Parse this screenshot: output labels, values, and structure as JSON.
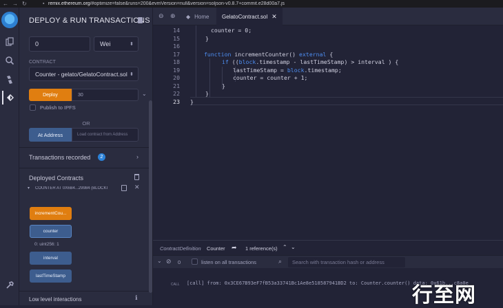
{
  "browser": {
    "url_host": "remix.ethereum.org",
    "url_rest": "/#optimize=false&runs=200&evmVersion=null&version=soljson-v0.8.7+commit.e28d00a7.js"
  },
  "panel": {
    "title": "DEPLOY & RUN TRANSACTIONS",
    "value": "0",
    "value_unit": "Wei",
    "contract_label": "CONTRACT",
    "contract_selected": "Counter - gelato/GelatoContract.sol",
    "deploy_label": "Deploy",
    "deploy_arg": "30",
    "publish_ipfs": "Publish to IPFS",
    "or": "OR",
    "at_address_label": "At Address",
    "at_address_placeholder": "Load contract from Address",
    "transactions_recorded": "Transactions recorded",
    "transactions_count": "2",
    "deployed_contracts": "Deployed Contracts",
    "instance_name": "COUNTER AT 0X6B4...29984 (BLOCKI",
    "functions": {
      "incrementCounter": "incrementCou...",
      "counter": "counter",
      "counter_result": "0: uint256: 1",
      "interval": "interval",
      "lastTimeStamp": "lastTimeStamp"
    },
    "low_level": "Low level interactions"
  },
  "tabs": {
    "home": "Home",
    "file": "GelatoContract.sol"
  },
  "editor": {
    "lines": [
      {
        "n": "14",
        "text": "counter = 0;"
      },
      {
        "n": "15",
        "text": "}"
      },
      {
        "n": "16",
        "text": ""
      },
      {
        "n": "17",
        "kw": "function",
        "text": " incrementCounter() ",
        "kw2": "external",
        "tail": " {"
      },
      {
        "n": "18",
        "kw": "if",
        "text": " ((",
        "kw2": "block",
        "tail": ".timestamp - lastTimeStamp) > interval ) {"
      },
      {
        "n": "19",
        "text": "lastTimeStamp = ",
        "kw2": "block",
        "tail": ".timestamp;"
      },
      {
        "n": "20",
        "text": "counter = counter + 1;"
      },
      {
        "n": "21",
        "text": "}"
      },
      {
        "n": "22",
        "text": "}"
      },
      {
        "n": "23",
        "text": "}"
      }
    ]
  },
  "defbar": {
    "def": "ContractDefinition",
    "name": "Counter",
    "refs": "1 reference(s)"
  },
  "terminal": {
    "count": "0",
    "listen": "listen on all transactions",
    "search_placeholder": "Search with transaction hash or address",
    "log_badge": "CALL",
    "log_text": "[call]  from: 0x3CE67B93eF7fB53a33741Bc1Ae8e518587941BD2 to: Counter.counter() data: 0x61b...c8a0e"
  },
  "watermark": "行至网",
  "colors": {
    "accent_orange": "#e07e10",
    "accent_blue": "#3d5d8e",
    "keyword": "#4d8df0"
  }
}
